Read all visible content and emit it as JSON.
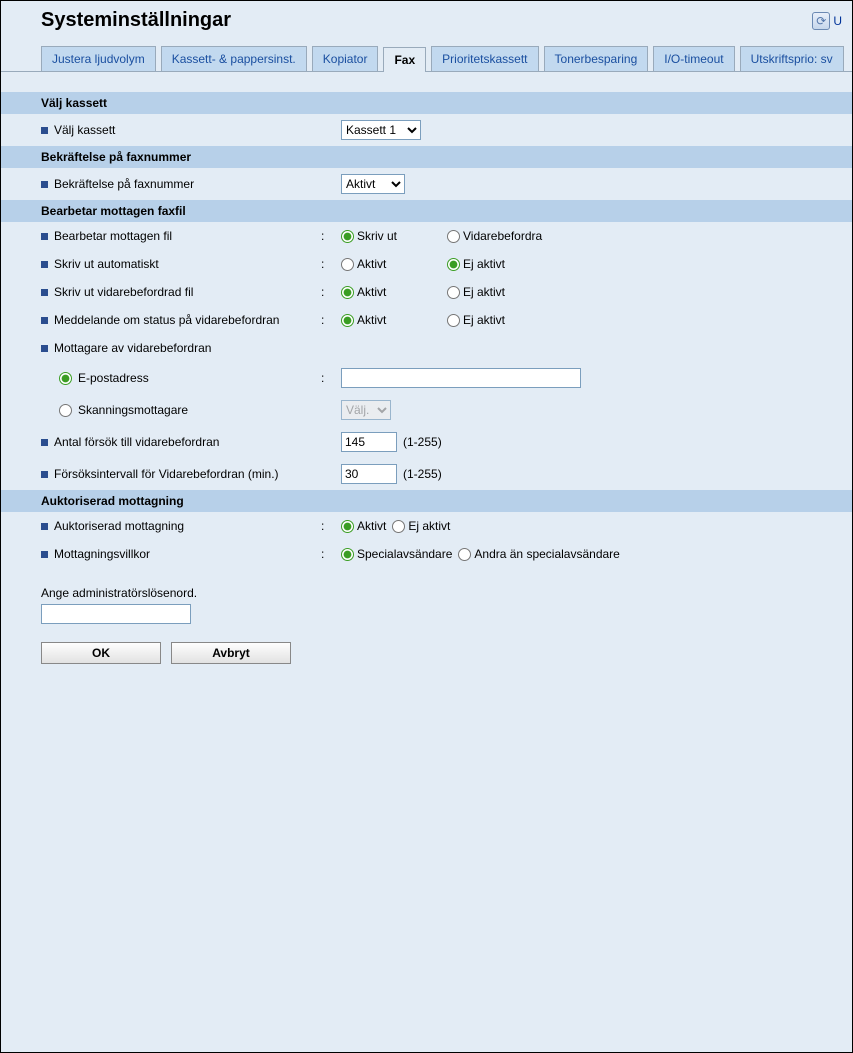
{
  "header": {
    "title": "Systeminställningar",
    "refresh_label": "U"
  },
  "tabs": [
    "Justera ljudvolym",
    "Kassett- & pappersinst.",
    "Kopiator",
    "Fax",
    "Prioritetskassett",
    "Tonerbesparing",
    "I/O-timeout",
    "Utskriftsprio: sv"
  ],
  "sections": {
    "valj_kassett": {
      "header": "Välj kassett",
      "label": "Välj kassett",
      "select_value": "Kassett 1"
    },
    "bekraftelse": {
      "header": "Bekräftelse på faxnummer",
      "label": "Bekräftelse på faxnummer",
      "select_value": "Aktivt"
    },
    "bearbetar": {
      "header": "Bearbetar mottagen faxfil",
      "row1_label": "Bearbetar mottagen fil",
      "row1_opt1": "Skriv ut",
      "row1_opt2": "Vidarebefordra",
      "row2_label": "Skriv ut automatiskt",
      "row2_opt1": "Aktivt",
      "row2_opt2": "Ej aktivt",
      "row3_label": "Skriv ut vidarebefordrad fil",
      "row3_opt1": "Aktivt",
      "row3_opt2": "Ej aktivt",
      "row4_label": "Meddelande om status på vidarebefordran",
      "row4_opt1": "Aktivt",
      "row4_opt2": "Ej aktivt",
      "row5_label": "Mottagare av vidarebefordran",
      "row5a_label": "E-postadress",
      "row5a_value": "",
      "row5b_label": "Skanningsmottagare",
      "row5b_sel": "Välj.",
      "row6_label": "Antal försök till vidarebefordran",
      "row6_value": "145",
      "row6_hint": "(1-255)",
      "row7_label": "Försöksintervall för Vidarebefordran (min.)",
      "row7_value": "30",
      "row7_hint": "(1-255)"
    },
    "auktoriserad": {
      "header": "Auktoriserad mottagning",
      "row1_label": "Auktoriserad mottagning",
      "row1_opt1": "Aktivt",
      "row1_opt2": "Ej aktivt",
      "row2_label": "Mottagningsvillkor",
      "row2_opt1": "Specialavsändare",
      "row2_opt2": "Andra än specialavsändare"
    }
  },
  "admin": {
    "label": "Ange administratörslösenord.",
    "value": ""
  },
  "buttons": {
    "ok": "OK",
    "cancel": "Avbryt"
  }
}
